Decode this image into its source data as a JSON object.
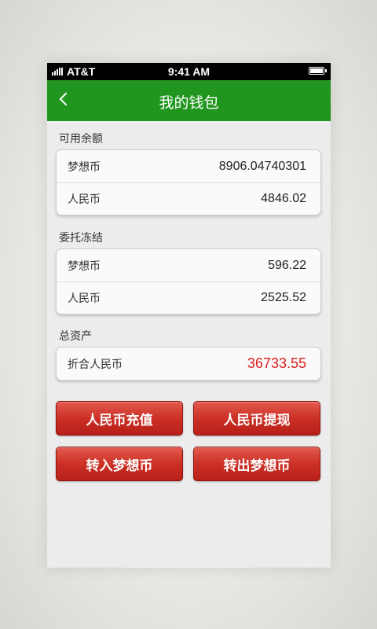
{
  "status_bar": {
    "carrier": "AT&T",
    "time": "9:41 AM"
  },
  "header": {
    "title": "我的钱包",
    "back_icon": "chevron-left-icon"
  },
  "available_balance": {
    "label": "可用余额",
    "rows": [
      {
        "label": "梦想币",
        "value": "8906.04740301"
      },
      {
        "label": "人民币",
        "value": "4846.02"
      }
    ]
  },
  "frozen": {
    "label": "委托冻结",
    "rows": [
      {
        "label": "梦想币",
        "value": "596.22"
      },
      {
        "label": "人民币",
        "value": "2525.52"
      }
    ]
  },
  "total_assets": {
    "label": "总资产",
    "row": {
      "label": "折合人民币",
      "value": "36733.55",
      "value_color": "#dd1f1f"
    }
  },
  "actions": {
    "deposit_rmb": "人民币充值",
    "withdraw_rmb": "人民币提现",
    "transfer_in": "转入梦想币",
    "transfer_out": "转出梦想币"
  },
  "colors": {
    "header_green": "#21961f",
    "button_red": "#cc3026"
  }
}
